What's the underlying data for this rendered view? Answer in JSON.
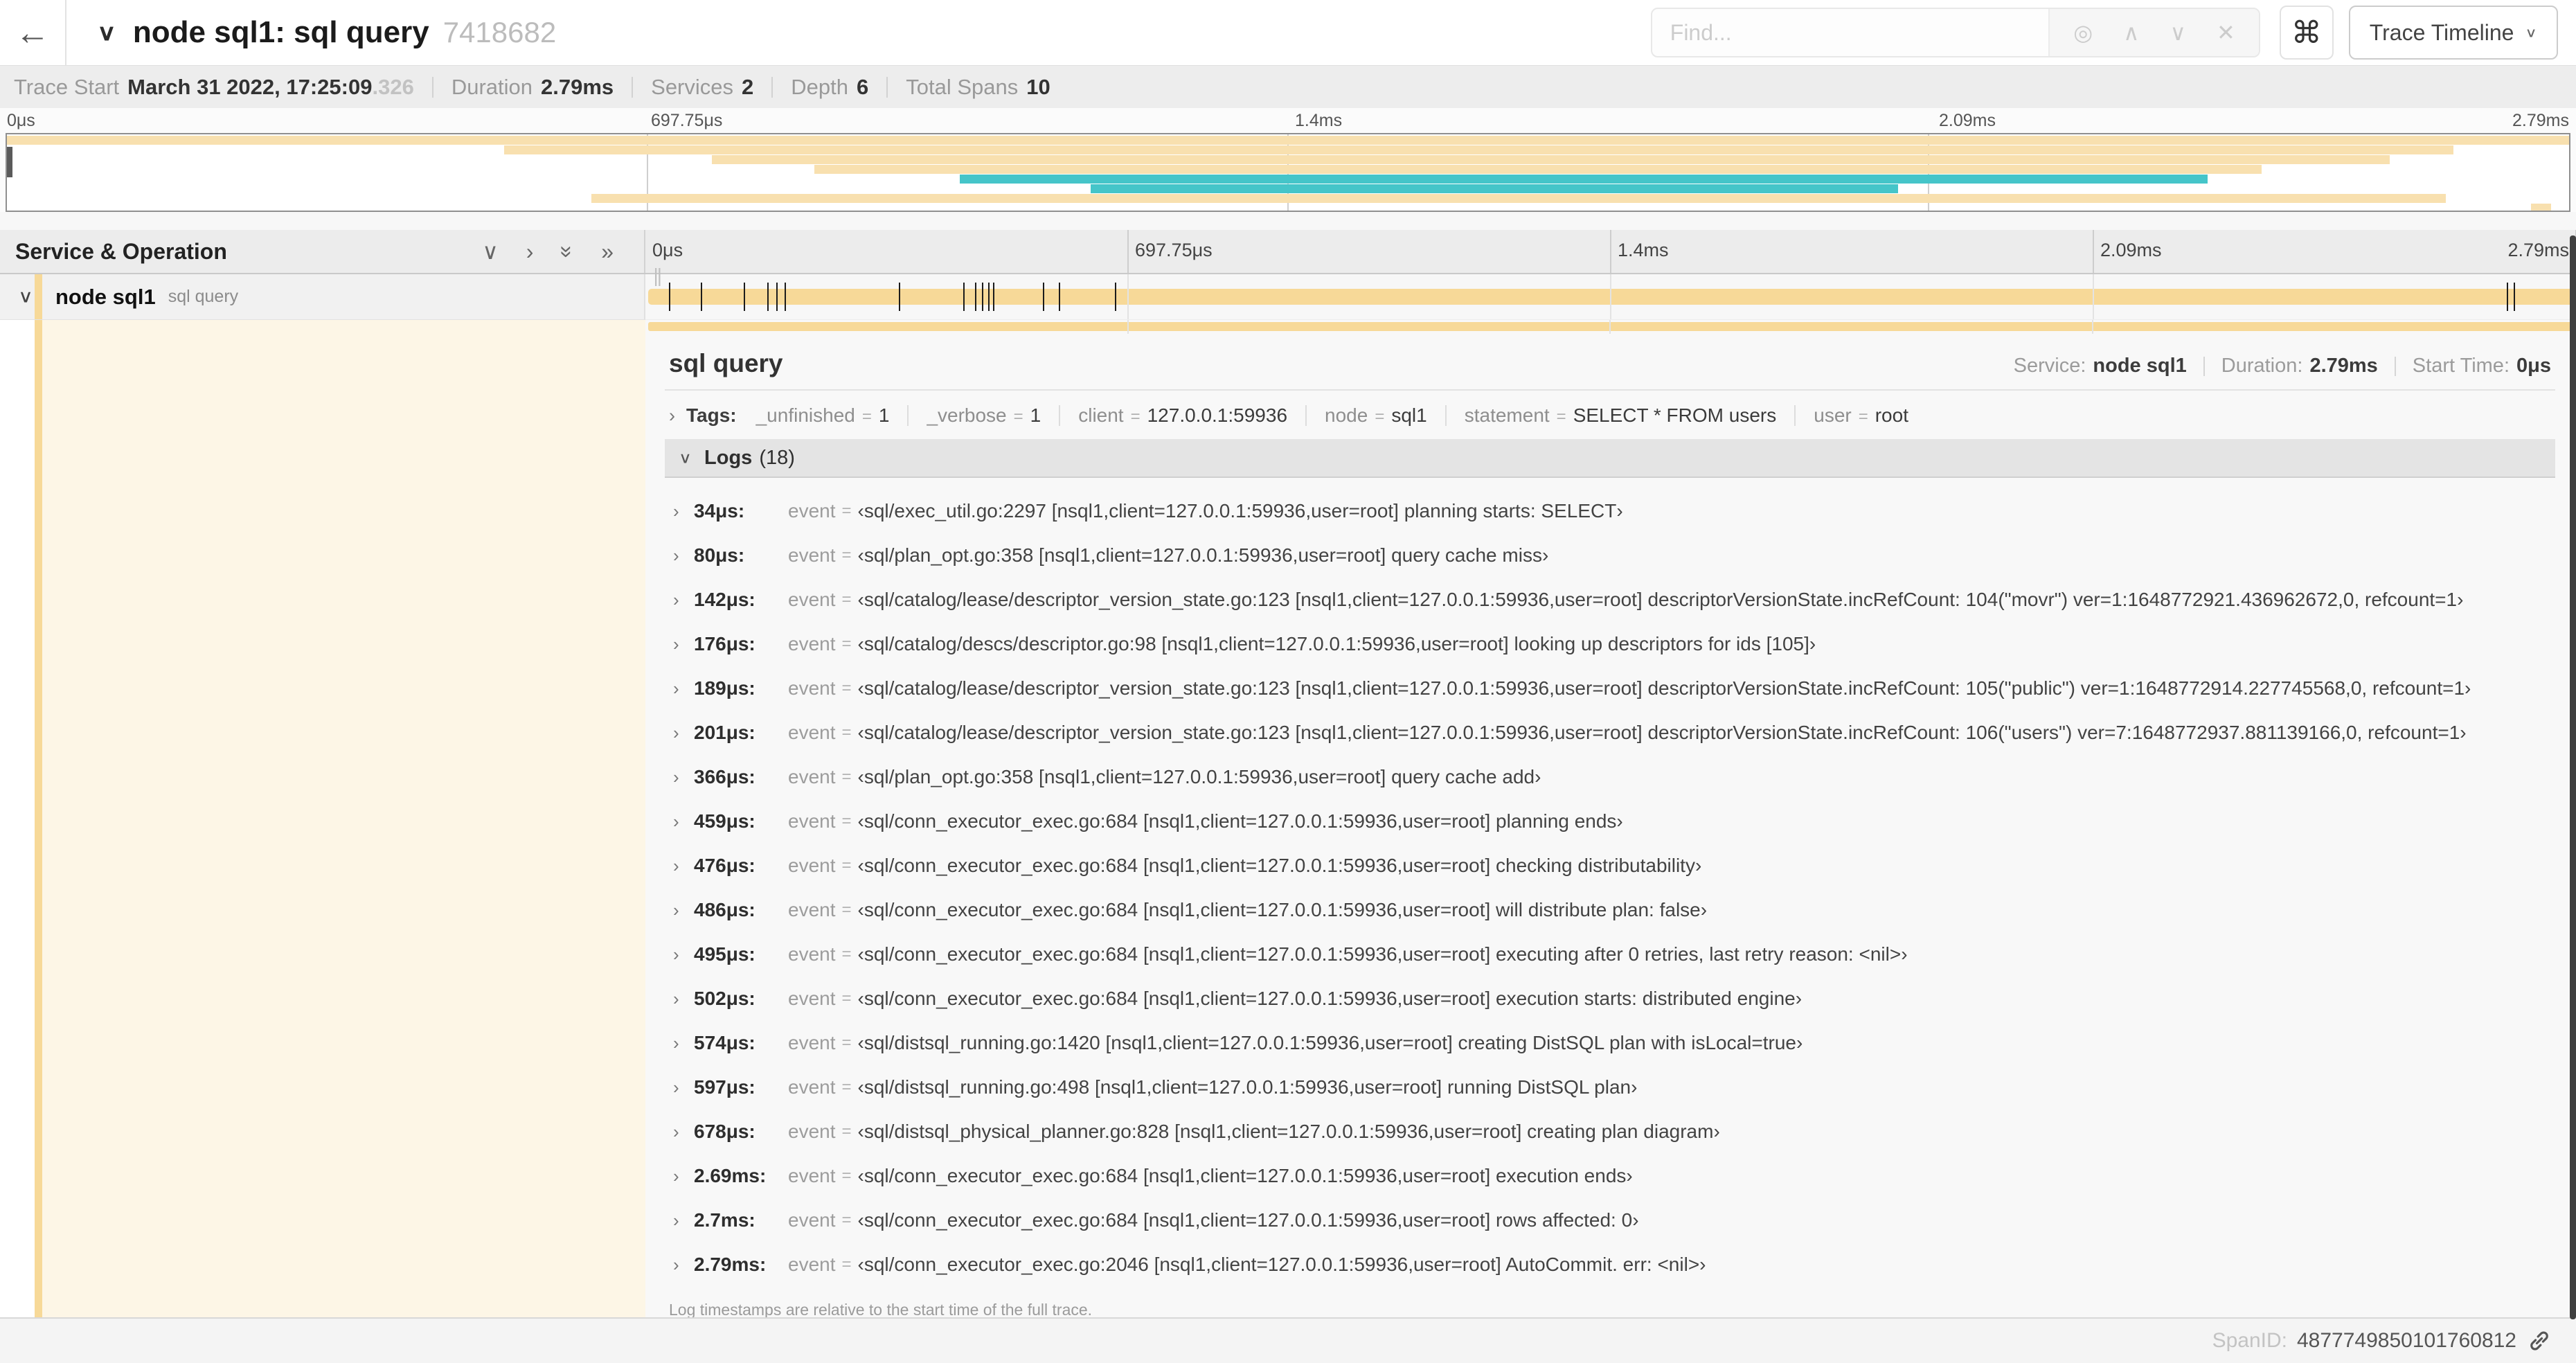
{
  "colors": {
    "tan": "#f7d998",
    "tan_light": "#f8e0af",
    "teal": "#45c5c9",
    "cream": "#fdf6e6"
  },
  "icons": {
    "back": "←",
    "collapse_down": "∨",
    "chevron_right": "›",
    "double_chevron_right": "»",
    "find_target": "◎",
    "find_prev": "∧",
    "find_next": "∨",
    "find_clear": "✕",
    "keyboard_shortcut": "⌘",
    "caret_down": "∨",
    "column_grip": "||"
  },
  "header": {
    "title": "node sql1: sql query",
    "trace_id": "7418682",
    "find_placeholder": "Find...",
    "view_selector_label": "Trace Timeline"
  },
  "summary": {
    "items": [
      {
        "label": "Trace Start",
        "value": "March 31 2022, 17:25:09",
        "suffix": ".326"
      },
      {
        "label": "Duration",
        "value": "2.79ms"
      },
      {
        "label": "Services",
        "value": "2"
      },
      {
        "label": "Depth",
        "value": "6"
      },
      {
        "label": "Total Spans",
        "value": "10"
      }
    ]
  },
  "timeline": {
    "duration_us": 2790,
    "ticks": [
      {
        "label": "0μs",
        "pos": 0
      },
      {
        "label": "697.75μs",
        "pos": 25
      },
      {
        "label": "1.4ms",
        "pos": 50
      },
      {
        "label": "2.09ms",
        "pos": 75
      },
      {
        "label": "2.79ms",
        "pos": 100
      }
    ],
    "grid_positions": [
      25,
      50,
      75,
      100
    ],
    "minimap_grid_positions": [
      25,
      50,
      75
    ],
    "minimap_spans": [
      {
        "row": 0,
        "start": 0,
        "end": 100,
        "color": "tan"
      },
      {
        "row": 1,
        "start": 19.4,
        "end": 95.5,
        "color": "tan"
      },
      {
        "row": 2,
        "start": 27.5,
        "end": 93.0,
        "color": "tan"
      },
      {
        "row": 3,
        "start": 31.5,
        "end": 88.0,
        "color": "tan"
      },
      {
        "row": 4,
        "start": 37.2,
        "end": 85.9,
        "color": "teal"
      },
      {
        "row": 5,
        "start": 42.3,
        "end": 73.8,
        "color": "teal"
      },
      {
        "row": 6,
        "start": 22.8,
        "end": 95.2,
        "color": "tan"
      },
      {
        "row": 7,
        "start": 98.5,
        "end": 99.3,
        "color": "tan"
      }
    ],
    "header_label": "Service & Operation",
    "row": {
      "service": "node sql1",
      "operation": "sql query"
    }
  },
  "detail": {
    "operation": "sql query",
    "meta": [
      {
        "label": "Service:",
        "value": "node sql1"
      },
      {
        "label": "Duration:",
        "value": "2.79ms"
      },
      {
        "label": "Start Time:",
        "value": "0μs"
      }
    ],
    "tags": {
      "label": "Tags:",
      "items": [
        {
          "key": "_unfinished",
          "value": "1"
        },
        {
          "key": "_verbose",
          "value": "1"
        },
        {
          "key": "client",
          "value": "127.0.0.1:59936"
        },
        {
          "key": "node",
          "value": "sql1"
        },
        {
          "key": "statement",
          "value": "SELECT * FROM users"
        },
        {
          "key": "user",
          "value": "root"
        }
      ]
    },
    "logs": {
      "label": "Logs",
      "count": "(18)",
      "field_key": "event",
      "entries": [
        {
          "time": "34μs:",
          "time_us": 34,
          "value": "‹sql/exec_util.go:2297 [nsql1,client=127.0.0.1:59936,user=root] planning starts: SELECT›"
        },
        {
          "time": "80μs:",
          "time_us": 80,
          "value": "‹sql/plan_opt.go:358 [nsql1,client=127.0.0.1:59936,user=root] query cache miss›"
        },
        {
          "time": "142μs:",
          "time_us": 142,
          "value": "‹sql/catalog/lease/descriptor_version_state.go:123 [nsql1,client=127.0.0.1:59936,user=root] descriptorVersionState.incRefCount: 104(\"movr\") ver=1:1648772921.436962672,0, refcount=1›"
        },
        {
          "time": "176μs:",
          "time_us": 176,
          "value": "‹sql/catalog/descs/descriptor.go:98 [nsql1,client=127.0.0.1:59936,user=root] looking up descriptors for ids [105]›"
        },
        {
          "time": "189μs:",
          "time_us": 189,
          "value": "‹sql/catalog/lease/descriptor_version_state.go:123 [nsql1,client=127.0.0.1:59936,user=root] descriptorVersionState.incRefCount: 105(\"public\") ver=1:1648772914.227745568,0, refcount=1›"
        },
        {
          "time": "201μs:",
          "time_us": 201,
          "value": "‹sql/catalog/lease/descriptor_version_state.go:123 [nsql1,client=127.0.0.1:59936,user=root] descriptorVersionState.incRefCount: 106(\"users\") ver=7:1648772937.881139166,0, refcount=1›"
        },
        {
          "time": "366μs:",
          "time_us": 366,
          "value": "‹sql/plan_opt.go:358 [nsql1,client=127.0.0.1:59936,user=root] query cache add›"
        },
        {
          "time": "459μs:",
          "time_us": 459,
          "value": "‹sql/conn_executor_exec.go:684 [nsql1,client=127.0.0.1:59936,user=root] planning ends›"
        },
        {
          "time": "476μs:",
          "time_us": 476,
          "value": "‹sql/conn_executor_exec.go:684 [nsql1,client=127.0.0.1:59936,user=root] checking distributability›"
        },
        {
          "time": "486μs:",
          "time_us": 486,
          "value": "‹sql/conn_executor_exec.go:684 [nsql1,client=127.0.0.1:59936,user=root] will distribute plan: false›"
        },
        {
          "time": "495μs:",
          "time_us": 495,
          "value": "‹sql/conn_executor_exec.go:684 [nsql1,client=127.0.0.1:59936,user=root] executing after 0 retries, last retry reason: <nil>›"
        },
        {
          "time": "502μs:",
          "time_us": 502,
          "value": "‹sql/conn_executor_exec.go:684 [nsql1,client=127.0.0.1:59936,user=root] execution starts: distributed engine›"
        },
        {
          "time": "574μs:",
          "time_us": 574,
          "value": "‹sql/distsql_running.go:1420 [nsql1,client=127.0.0.1:59936,user=root] creating DistSQL plan with isLocal=true›"
        },
        {
          "time": "597μs:",
          "time_us": 597,
          "value": "‹sql/distsql_running.go:498 [nsql1,client=127.0.0.1:59936,user=root] running DistSQL plan›"
        },
        {
          "time": "678μs:",
          "time_us": 678,
          "value": "‹sql/distsql_physical_planner.go:828 [nsql1,client=127.0.0.1:59936,user=root] creating plan diagram›"
        },
        {
          "time": "2.69ms:",
          "time_us": 2690,
          "value": "‹sql/conn_executor_exec.go:684 [nsql1,client=127.0.0.1:59936,user=root] execution ends›"
        },
        {
          "time": "2.7ms:",
          "time_us": 2700,
          "value": "‹sql/conn_executor_exec.go:684 [nsql1,client=127.0.0.1:59936,user=root] rows affected: 0›"
        },
        {
          "time": "2.79ms:",
          "time_us": 2790,
          "value": "‹sql/conn_executor_exec.go:2046 [nsql1,client=127.0.0.1:59936,user=root] AutoCommit. err: <nil>›"
        }
      ],
      "footnote": "Log timestamps are relative to the start time of the full trace."
    }
  },
  "footer": {
    "span_id_label": "SpanID:",
    "span_id": "4877749850101760812"
  }
}
